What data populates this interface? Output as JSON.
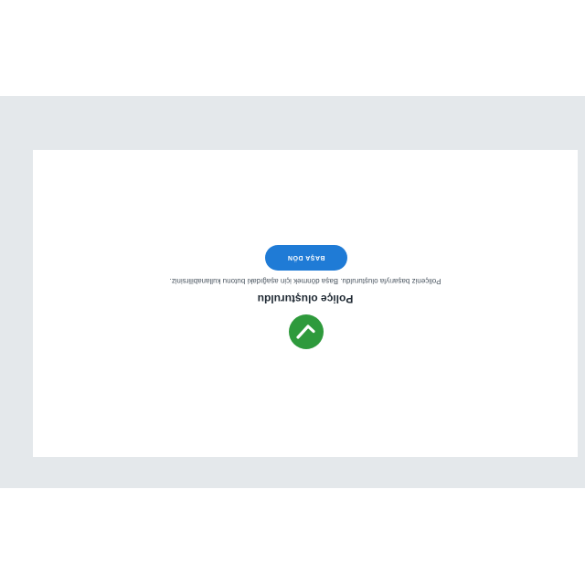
{
  "dialog": {
    "icon": "checkmark-icon",
    "title": "Poliçe oluşturuldu",
    "message": "Poliçeniz başarıyla oluşturuldu. Başa dönmek için aşağıdaki butonu kullanabilirsiniz.",
    "button_label": "BAŞA DÖN"
  },
  "colors": {
    "backdrop": "#e4e8eb",
    "card": "#ffffff",
    "success": "#2e9a3c",
    "primary": "#1f7bd6"
  },
  "orientation": "rotated-180"
}
